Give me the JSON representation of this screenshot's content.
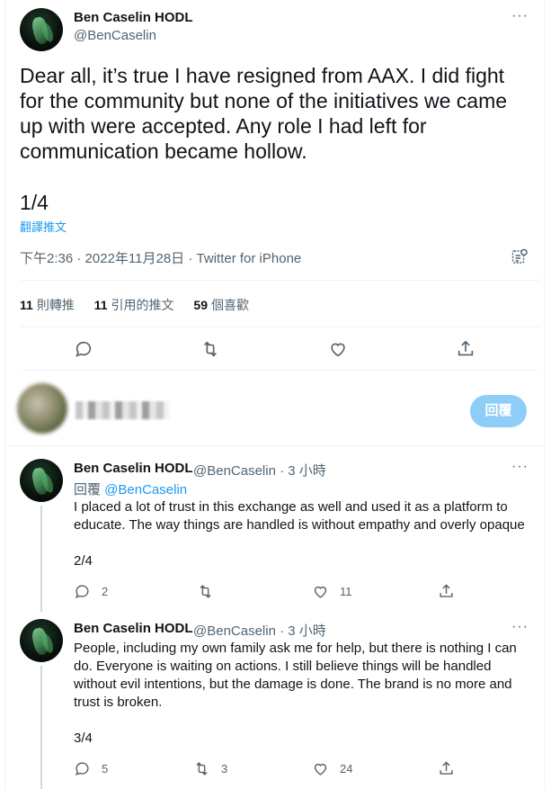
{
  "main_tweet": {
    "author_name": "Ben Caselin HODL",
    "handle": "@BenCaselin",
    "more": "···",
    "text": "Dear all, it’s true I have resigned from AAX. I did fight for the community but none of the initiatives we came up with were accepted. Any role I had left for communication became hollow.",
    "thread_count": "1/4",
    "translate": "翻譯推文",
    "time": "下午2:36",
    "date": "2022年11月28日",
    "separator": " · ",
    "source": "Twitter for iPhone",
    "stats": {
      "retweets_count": "11",
      "retweets_label": "則轉推",
      "quotes_count": "11",
      "quotes_label": "引用的推文",
      "likes_count": "59",
      "likes_label": "個喜歡"
    },
    "actions": [
      "reply-icon",
      "retweet-icon",
      "like-icon",
      "share-icon"
    ]
  },
  "composer": {
    "reply_button": "回覆"
  },
  "replies": [
    {
      "author_name": "Ben Caselin HODL",
      "handle": "@BenCaselin",
      "time": " · 3 小時",
      "more": "···",
      "replying_label": "回覆 ",
      "replying_mention": "@BenCaselin",
      "text": "I placed a lot of trust in this exchange as well and used it as a platform to educate. The way things are handled is without empathy and overly opaque",
      "thread_count": "2/4",
      "reply_count": "2",
      "retweet_count": "",
      "like_count": "11"
    },
    {
      "author_name": "Ben Caselin HODL",
      "handle": "@BenCaselin",
      "time": " · 3 小時",
      "more": "···",
      "text": "People, including my own family ask me for help, but there is nothing I can do. Everyone is waiting on actions. I still believe things will be handled without evil intentions, but the damage is done. The brand is no more and trust is broken.",
      "thread_count": "3/4",
      "reply_count": "5",
      "retweet_count": "3",
      "like_count": "24"
    }
  ],
  "colors": {
    "text": "#0f1419",
    "secondary": "#536471",
    "accent": "#1d9bf0",
    "reply_button_disabled": "#8ecdf8"
  }
}
